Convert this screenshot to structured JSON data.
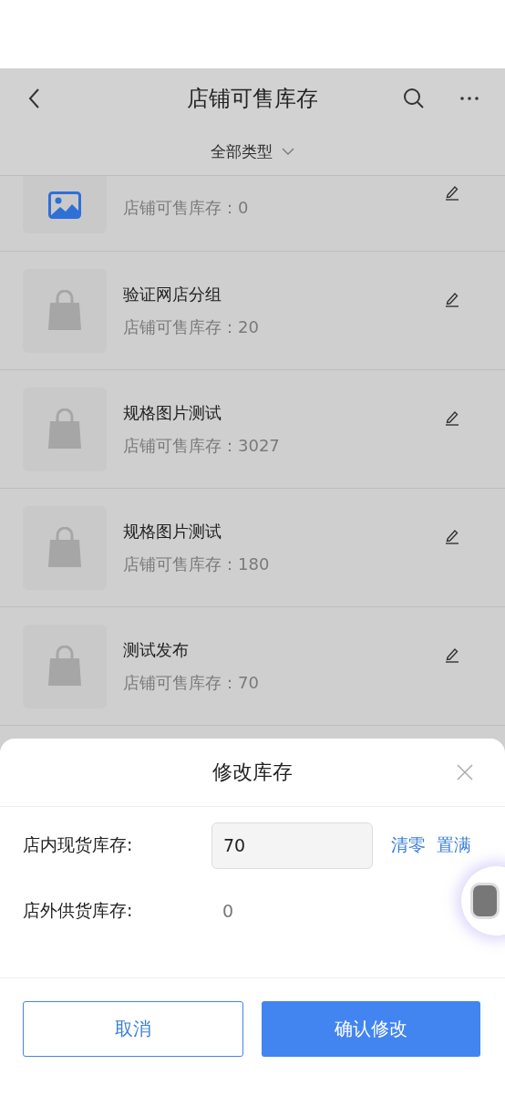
{
  "header": {
    "title": "店铺可售库存"
  },
  "filter": {
    "label": "全部类型"
  },
  "items": [
    {
      "stock": "店铺可售库存：0",
      "kind": "image"
    },
    {
      "title": "验证网店分组",
      "stock": "店铺可售库存：20",
      "kind": "bag"
    },
    {
      "title": "规格图片测试",
      "stock": "店铺可售库存：3027",
      "kind": "bag"
    },
    {
      "title": "规格图片测试",
      "stock": "店铺可售库存：180",
      "kind": "bag"
    },
    {
      "title": "测试发布",
      "stock": "店铺可售库存：70",
      "kind": "bag"
    }
  ],
  "sheet": {
    "title": "修改库存",
    "rows": [
      {
        "kind": "input",
        "label": "店内现货库存:",
        "value": "70",
        "actions": [
          "清零",
          "置满"
        ]
      },
      {
        "kind": "text",
        "label": "店外供货库存:",
        "value": "0"
      }
    ],
    "buttons": [
      {
        "label": "取消",
        "kind": "secondary"
      },
      {
        "label": "确认修改",
        "kind": "primary"
      }
    ]
  }
}
